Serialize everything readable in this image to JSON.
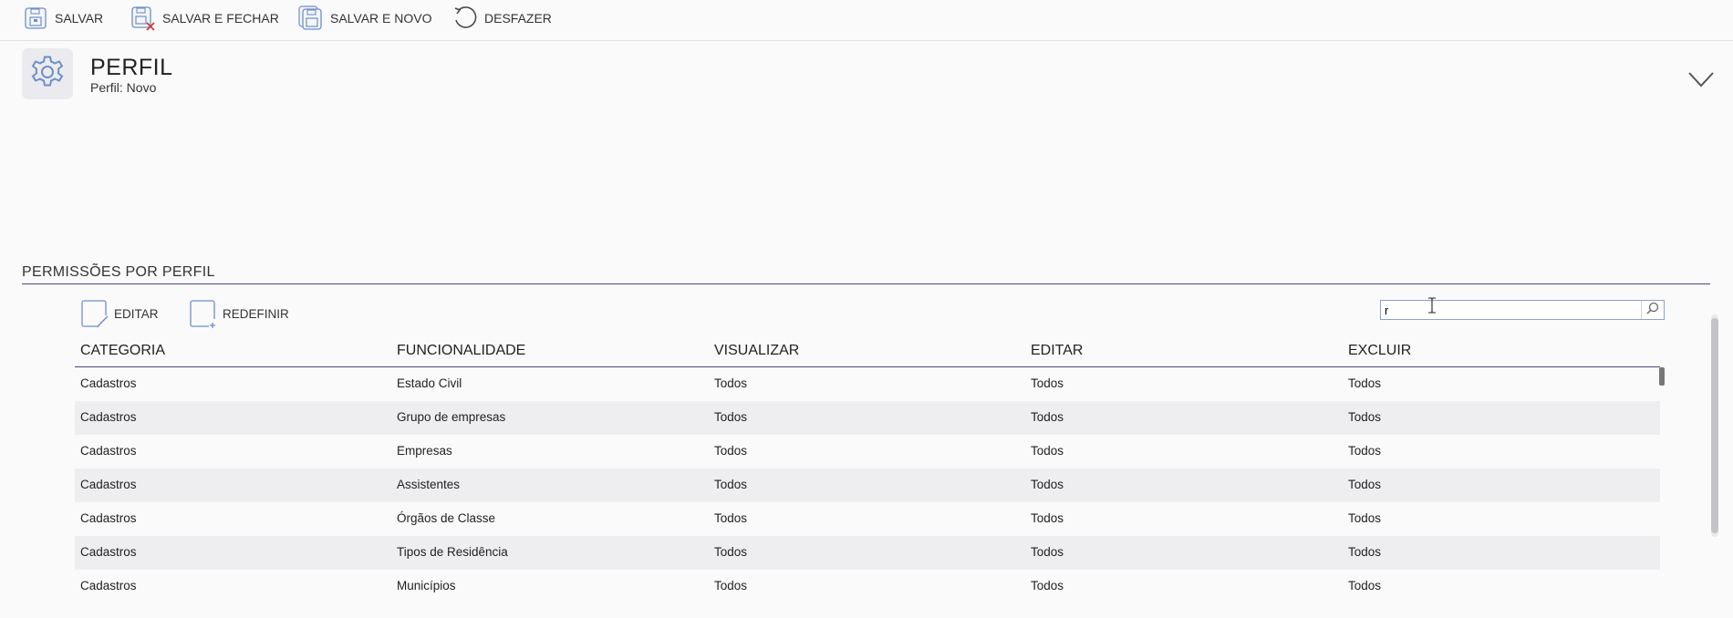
{
  "toolbar": {
    "save_label": "SALVAR",
    "save_close_label": "SALVAR E FECHAR",
    "save_new_label": "SALVAR E NOVO",
    "undo_label": "DESFAZER"
  },
  "header": {
    "title": "PERFIL",
    "subtitle": "Perfil: Novo",
    "icon": "gear-icon"
  },
  "section": {
    "title": "PERMISSÕES POR PERFIL",
    "edit_label": "EDITAR",
    "reset_label": "REDEFINIR"
  },
  "search": {
    "value": "r",
    "placeholder": ""
  },
  "table": {
    "columns": [
      "CATEGORIA",
      "FUNCIONALIDADE",
      "VISUALIZAR",
      "EDITAR",
      "EXCLUIR"
    ],
    "rows": [
      [
        "Cadastros",
        "Estado Civil",
        "Todos",
        "Todos",
        "Todos"
      ],
      [
        "Cadastros",
        "Grupo de empresas",
        "Todos",
        "Todos",
        "Todos"
      ],
      [
        "Cadastros",
        "Empresas",
        "Todos",
        "Todos",
        "Todos"
      ],
      [
        "Cadastros",
        "Assistentes",
        "Todos",
        "Todos",
        "Todos"
      ],
      [
        "Cadastros",
        "Órgãos de Classe",
        "Todos",
        "Todos",
        "Todos"
      ],
      [
        "Cadastros",
        "Tipos de Residência",
        "Todos",
        "Todos",
        "Todos"
      ],
      [
        "Cadastros",
        "Municípios",
        "Todos",
        "Todos",
        "Todos"
      ]
    ]
  },
  "colors": {
    "accent": "#4a4a7a",
    "icon_blue": "#6e8fc9",
    "delete_red": "#d23a3a",
    "alt_row": "#eeeef0"
  }
}
